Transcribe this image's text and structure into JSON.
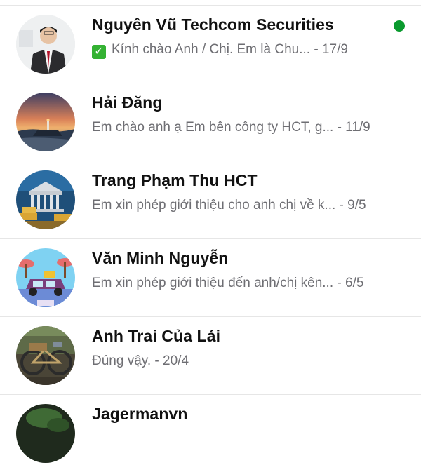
{
  "conversations": [
    {
      "name": "Nguyên Vũ Techcom Securities",
      "preview": "Kính chào Anh / Chị.  Em là Chu...",
      "time": " - 17/9",
      "avatar_icon": "person-portrait-avatar",
      "verified_icon": "green-check-icon",
      "online": true
    },
    {
      "name": "Hải Đăng",
      "preview": "Em chào anh ạ Em bên công ty HCT, g...",
      "time": " - 11/9",
      "avatar_icon": "lighthouse-sunset-avatar"
    },
    {
      "name": "Trang Phạm Thu HCT",
      "preview": "Em xin phép giới thiệu cho anh chị về k...",
      "time": " - 9/5",
      "avatar_icon": "bank-building-gold-avatar"
    },
    {
      "name": "Văn Minh Nguyễn",
      "preview": "Em xin phép giới thiệu đến anh/chị kên...",
      "time": " - 6/5",
      "avatar_icon": "cartoon-car-avatar"
    },
    {
      "name": "Anh Trai Của Lái",
      "preview": "Đúng vậy.",
      "time": " - 20/4",
      "avatar_icon": "bicycle-avatar"
    },
    {
      "name": "Jagermanvn",
      "avatar_icon": "dark-green-avatar"
    }
  ],
  "colors": {
    "online": "#0a9a2e",
    "name": "#111111",
    "preview": "#6e6e73",
    "divider": "#e6e6e6"
  }
}
